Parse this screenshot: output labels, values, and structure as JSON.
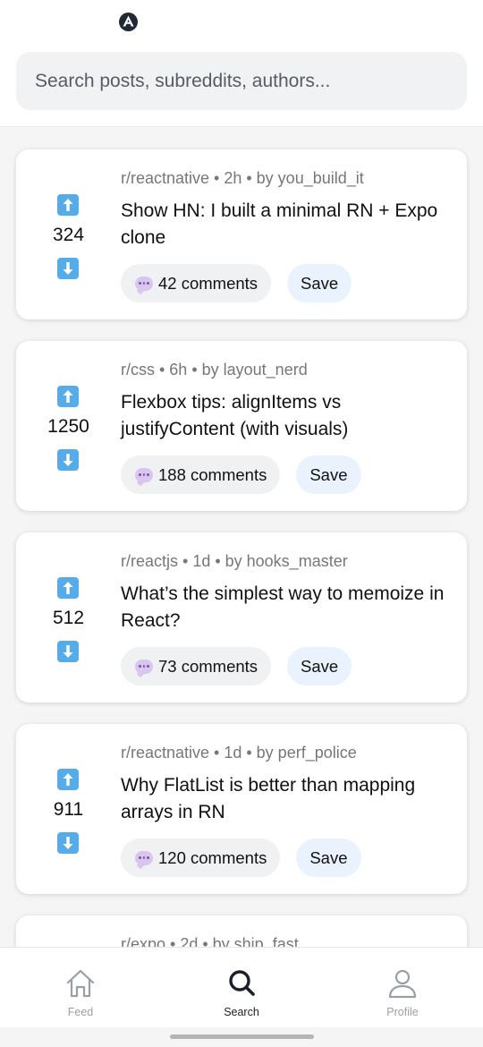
{
  "header": {
    "logo_icon": "app-logo-icon",
    "search_placeholder": "Search posts, subreddits, authors..."
  },
  "colors": {
    "vote_arrow": "#55ace8",
    "save_bg": "#eaf3fd",
    "comments_bg": "#f0f1f3"
  },
  "posts": [
    {
      "meta": "r/reactnative • 2h • by you_build_it",
      "title": "Show HN: I built a minimal RN + Expo clone",
      "score": "324",
      "comments": "42 comments",
      "save": "Save"
    },
    {
      "meta": "r/css • 6h • by layout_nerd",
      "title": "Flexbox tips: alignItems vs justifyContent (with visuals)",
      "score": "1250",
      "comments": "188 comments",
      "save": "Save"
    },
    {
      "meta": "r/reactjs • 1d • by hooks_master",
      "title": "What’s the simplest way to memoize in React?",
      "score": "512",
      "comments": "73 comments",
      "save": "Save"
    },
    {
      "meta": "r/reactnative • 1d • by perf_police",
      "title": "Why FlatList is better than mapping arrays in RN",
      "score": "911",
      "comments": "120 comments",
      "save": "Save"
    },
    {
      "meta": "r/expo • 2d • by ship_fast"
    }
  ],
  "tabs": [
    {
      "label": "Feed",
      "icon": "home-icon",
      "active": false
    },
    {
      "label": "Search",
      "icon": "search-icon",
      "active": true
    },
    {
      "label": "Profile",
      "icon": "user-icon",
      "active": false
    }
  ]
}
